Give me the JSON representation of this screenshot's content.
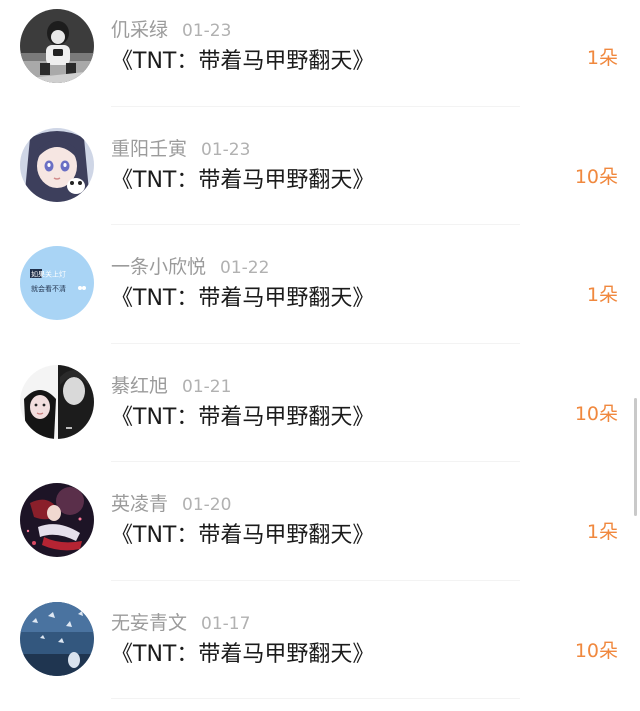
{
  "list": {
    "items": [
      {
        "name": "仉采绿",
        "date": "01-23",
        "title": "《TNT：带着马甲野翻天》",
        "gift": "1朵",
        "avatar": "avatar-boy-camera"
      },
      {
        "name": "重阳壬寅",
        "date": "01-23",
        "title": "《TNT：带着马甲野翻天》",
        "gift": "10朵",
        "avatar": "avatar-anime-girl"
      },
      {
        "name": "一条小欣悦",
        "date": "01-22",
        "title": "《TNT：带着马甲野翻天》",
        "gift": "1朵",
        "avatar": "avatar-text-sticker",
        "avatar_text": [
          "如果关上灯",
          "就会看不清"
        ]
      },
      {
        "name": "綦红旭",
        "date": "01-21",
        "title": "《TNT：带着马甲野翻天》",
        "gift": "10朵",
        "avatar": "avatar-couple-photo"
      },
      {
        "name": "英凌青",
        "date": "01-20",
        "title": "《TNT：带着马甲野翻天》",
        "gift": "1朵",
        "avatar": "avatar-dark-illustration"
      },
      {
        "name": "无妄青文",
        "date": "01-17",
        "title": "《TNT：带着马甲野翻天》",
        "gift": "10朵",
        "avatar": "avatar-blue-butterflies"
      }
    ]
  },
  "colors": {
    "name": "#9b9b9b",
    "date": "#b1b1b1",
    "title": "#1b1b1b",
    "gift": "#f0883e",
    "avatar_sticker_bg": "#a9d4f5"
  }
}
